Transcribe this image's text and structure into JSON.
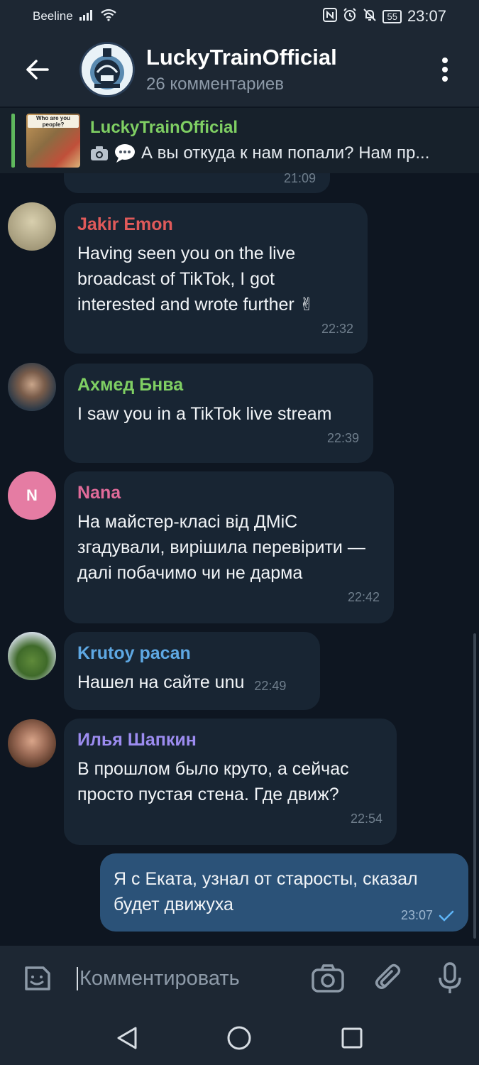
{
  "status_bar": {
    "carrier": "Beeline",
    "battery": "55",
    "time": "23:07"
  },
  "header": {
    "title": "LuckyTrainOfficial",
    "subtitle": "26 комментариев"
  },
  "pinned": {
    "thumb_text": "Who are you people?",
    "name": "LuckyTrainOfficial",
    "preview": "А вы откуда к нам попали? Нам пр..."
  },
  "partial_message": {
    "time": "21:09"
  },
  "messages": [
    {
      "sender": "Jakir Emon",
      "sender_color": "#e05a5a",
      "text": "Having seen you on the live broadcast of TikTok, I got interested and wrote further ✌",
      "time": "22:32"
    },
    {
      "sender": "Ахмед Бнва",
      "sender_color": "#7fcf63",
      "text": "I saw you in a TikTok live stream",
      "time": "22:39"
    },
    {
      "sender": "Nana",
      "sender_color": "#e16b9a",
      "avatar_letter": "N",
      "avatar_color": "#e57ca3",
      "text": "На майстер-класі від ДМіС згадували, вирішила перевірити — далі побачимо чи не дарма",
      "time": "22:42"
    },
    {
      "sender": "Krutoy pacan",
      "sender_color": "#5ea8e3",
      "text": "Нашел на сайте unu",
      "time": "22:49"
    },
    {
      "sender": "Илья Шапкин",
      "sender_color": "#9c8cf0",
      "text": "В прошлом было круто, а сейчас просто пустая стена. Где движ?",
      "time": "22:54"
    }
  ],
  "outgoing": {
    "text": "Я с Еката, узнал от старосты, сказал будет движуха",
    "time": "23:07"
  },
  "composer": {
    "placeholder": "Комментировать"
  },
  "colors": {
    "background": "#0e1621",
    "bar": "#1d2733",
    "bubble_in": "#182533",
    "bubble_out": "#2b5278"
  }
}
